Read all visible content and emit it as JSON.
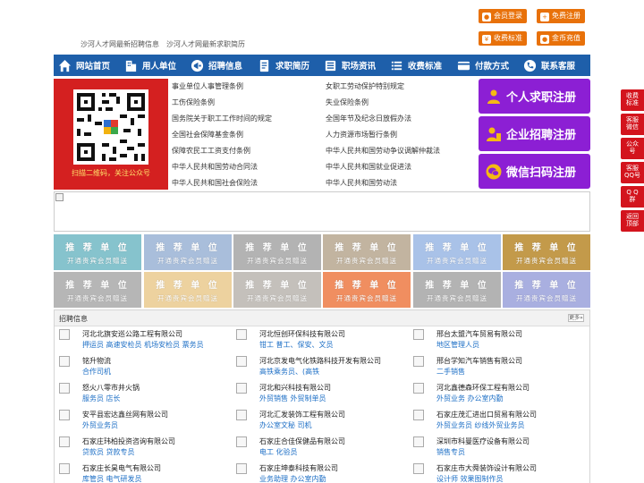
{
  "header": {
    "tagline": [
      "沙河人才网最新招聘信息",
      "沙河人才网最新求职简历"
    ],
    "buttons": [
      {
        "label": "会员登录",
        "icon": "user-icon"
      },
      {
        "label": "免费注册",
        "icon": "register-icon"
      },
      {
        "label": "收费标准",
        "icon": "fee-icon"
      },
      {
        "label": "金币充值",
        "icon": "coin-icon"
      }
    ]
  },
  "nav": [
    {
      "label": "网站首页",
      "icon": "home-icon"
    },
    {
      "label": "用人单位",
      "icon": "building-icon"
    },
    {
      "label": "招聘信息",
      "icon": "megaphone-icon"
    },
    {
      "label": "求职简历",
      "icon": "resume-icon"
    },
    {
      "label": "职场资讯",
      "icon": "news-icon"
    },
    {
      "label": "收费标准",
      "icon": "list-icon"
    },
    {
      "label": "付款方式",
      "icon": "wallet-icon"
    },
    {
      "label": "联系客服",
      "icon": "phone-icon"
    }
  ],
  "qr": {
    "caption": "扫描二维码，关注公众号"
  },
  "laws": {
    "left": [
      "事业单位人事管理条例",
      "工伤保险条例",
      "国务院关于职工工作时间的规定",
      "全国社会保障基金条例",
      "保障农民工工资支付条例",
      "中华人民共和国劳动合同法",
      "中华人民共和国社会保险法"
    ],
    "right": [
      "女职工劳动保护特别规定",
      "失业保险条例",
      "全国年节及纪念日放假办法",
      "人力资源市场暂行条例",
      "中华人民共和国劳动争议调解仲裁法",
      "中华人民共和国就业促进法",
      "中华人民共和国劳动法"
    ]
  },
  "register": [
    {
      "label": "个人求职注册",
      "icon": "person-icon"
    },
    {
      "label": "企业招聘注册",
      "icon": "company-icon"
    },
    {
      "label": "微信扫码注册",
      "icon": "wechat-icon"
    }
  ],
  "ads": {
    "title": "推 荐 单 位",
    "subtitle": "开通贵宾会员赠送",
    "colors": [
      "#86c3cd",
      "#a9bedb",
      "#b3b3b3",
      "#c2b4a0",
      "#a9c2e8",
      "#c39a4a",
      "#b6b6b6",
      "#edd29f",
      "#c4c0bb",
      "#f08e60",
      "#b3b3b3",
      "#a9afe0"
    ]
  },
  "jobs": {
    "title": "招聘信息",
    "more": "更多»",
    "items": [
      {
        "company": "河北北旗安巡公路工程有限公司",
        "positions": "押运员 高速安检员 机场安检员 票务员"
      },
      {
        "company": "河北恒创环保科技有限公司",
        "positions": "钳工 普工、保安、文员"
      },
      {
        "company": "邢台太盟汽车贸易有限公司",
        "positions": "地区管理人员"
      },
      {
        "company": "铭升物流",
        "positions": "合作司机"
      },
      {
        "company": "河北京发电气化铁路科技开发有限公司",
        "positions": "高铁乘务员、(高铁"
      },
      {
        "company": "邢台学知汽车销售有限公司",
        "positions": "二手销售"
      },
      {
        "company": "怒火八零市井火锅",
        "positions": "服务员 店长"
      },
      {
        "company": "河北和兴科技有限公司",
        "positions": "外贸销售 外贸制单员"
      },
      {
        "company": "河北鑫德森环保工程有限公司",
        "positions": "外贸业务 办公室内勤"
      },
      {
        "company": "安平县宏达鑫丝网有限公司",
        "positions": "外贸业务员"
      },
      {
        "company": "河北汇发装饰工程有限公司",
        "positions": "办公室文秘 司机"
      },
      {
        "company": "石家庄茂汇进出口贸易有限公司",
        "positions": "外贸业务员 纱线外贸业务员"
      },
      {
        "company": "石家庄玮柏投资咨询有限公司",
        "positions": "贷款员 贷款专员"
      },
      {
        "company": "石家庄合佳保健品有限公司",
        "positions": "电工 化验员"
      },
      {
        "company": "深圳市科曼医疗设备有限公司",
        "positions": "销售专员"
      },
      {
        "company": "石家庄长昊电气有限公司",
        "positions": "库管员 电气研发员"
      },
      {
        "company": "石家庄坤泰科技有限公司",
        "positions": "业务助理 办公室内勤"
      },
      {
        "company": "石家庄市大舜装饰设计有限公司",
        "positions": "设计师 效果图制作员"
      }
    ]
  },
  "side": [
    "收费\n标准",
    "客服\n微信",
    "公众\n号",
    "客服\nQQ号",
    "Q Q\n群",
    "返回\n顶部"
  ]
}
